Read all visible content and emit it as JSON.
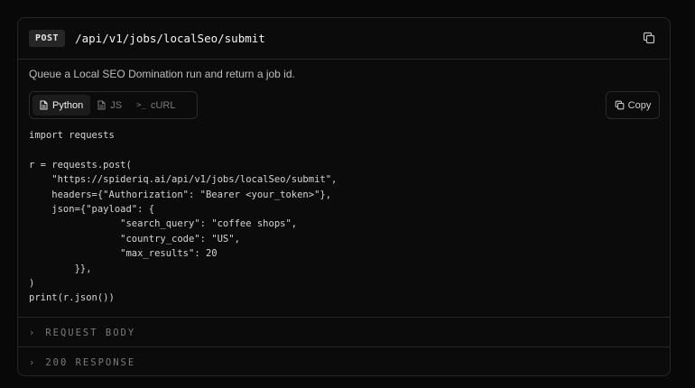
{
  "endpoint": {
    "method": "POST",
    "path": "/api/v1/jobs/localSeo/submit",
    "copy_icon": "copy-icon"
  },
  "description": "Queue a Local SEO Domination run and return a job id.",
  "tabs": [
    {
      "label": "Python",
      "icon": "file-icon",
      "active": true
    },
    {
      "label": "JS",
      "icon": "file-icon",
      "active": false
    },
    {
      "label": "cURL",
      "icon": "terminal-prompt-icon",
      "prompt": ">_",
      "active": false
    }
  ],
  "copy_button": {
    "label": "Copy",
    "icon": "copy-icon"
  },
  "code_lines": [
    "import requests",
    "",
    "r = requests.post(",
    "    \"https://spideriq.ai/api/v1/jobs/localSeo/submit\",",
    "    headers={\"Authorization\": \"Bearer <your_token>\"},",
    "    json={\"payload\": {",
    "                \"search_query\": \"coffee shops\",",
    "                \"country_code\": \"US\",",
    "                \"max_results\": 20",
    "        }},",
    ")",
    "print(r.json())"
  ],
  "sections": [
    {
      "chevron": "›",
      "label": "REQUEST BODY"
    },
    {
      "chevron": "›",
      "label": "200 RESPONSE"
    }
  ],
  "colors": {
    "background": "#080808",
    "card": "#0b0b0b",
    "border": "#262626"
  }
}
